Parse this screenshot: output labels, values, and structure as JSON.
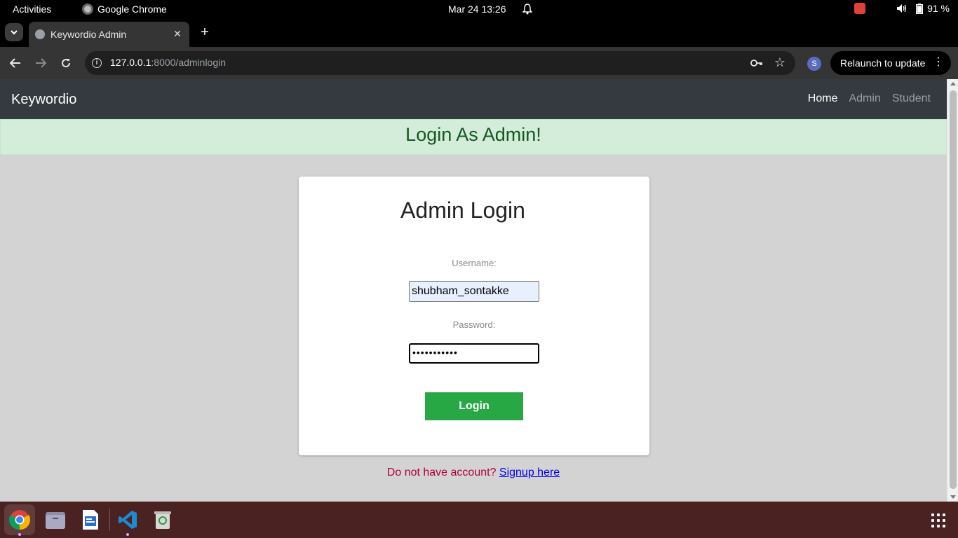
{
  "system": {
    "activities": "Activities",
    "app_name": "Google Chrome",
    "clock": "Mar 24  13:26",
    "battery": "91 %"
  },
  "browser": {
    "tab_title": "Keywordio Admin",
    "url_host": "127.0.0.1",
    "url_path": ":8000/adminlogin",
    "profile_initial": "S",
    "relaunch_label": "Relaunch to update"
  },
  "site": {
    "brand": "Keywordio",
    "nav": {
      "home": "Home",
      "admin": "Admin",
      "student": "Student"
    },
    "alert": "Login As Admin!",
    "card": {
      "title": "Admin Login",
      "username_label": "Username:",
      "username_value": "shubham_sontakke",
      "password_label": "Password:",
      "password_value": "•••••••••••",
      "login_label": "Login"
    },
    "signup_text": "Do not have account? ",
    "signup_link": "Signup here"
  },
  "dock": {
    "items": [
      "chrome-icon",
      "files-icon",
      "writer-icon",
      "vscode-icon",
      "trash-icon"
    ]
  }
}
